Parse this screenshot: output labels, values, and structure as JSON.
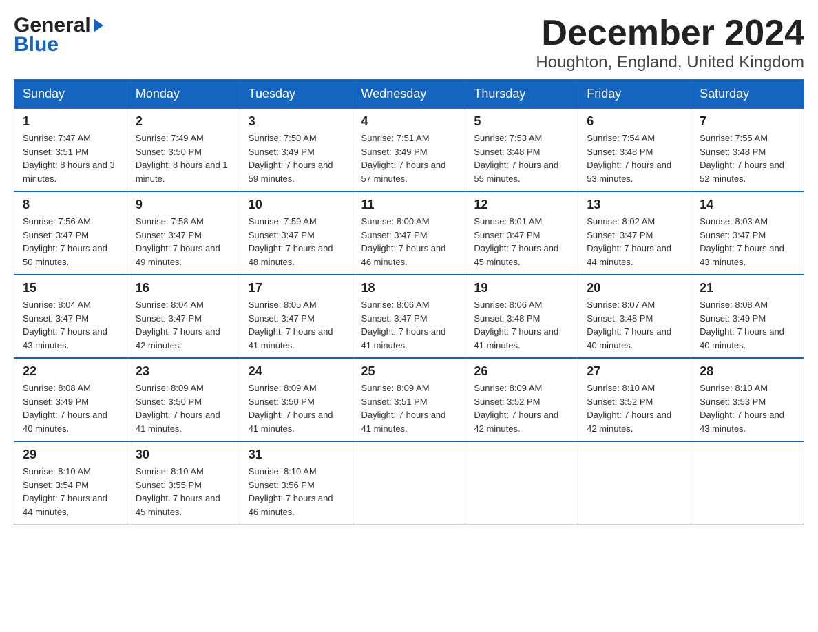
{
  "header": {
    "logo": {
      "line1": "General",
      "line2": "Blue",
      "arrow": "▶"
    },
    "title": "December 2024",
    "subtitle": "Houghton, England, United Kingdom"
  },
  "weekdays": [
    "Sunday",
    "Monday",
    "Tuesday",
    "Wednesday",
    "Thursday",
    "Friday",
    "Saturday"
  ],
  "weeks": [
    [
      {
        "day": "1",
        "sunrise": "7:47 AM",
        "sunset": "3:51 PM",
        "daylight": "8 hours and 3 minutes."
      },
      {
        "day": "2",
        "sunrise": "7:49 AM",
        "sunset": "3:50 PM",
        "daylight": "8 hours and 1 minute."
      },
      {
        "day": "3",
        "sunrise": "7:50 AM",
        "sunset": "3:49 PM",
        "daylight": "7 hours and 59 minutes."
      },
      {
        "day": "4",
        "sunrise": "7:51 AM",
        "sunset": "3:49 PM",
        "daylight": "7 hours and 57 minutes."
      },
      {
        "day": "5",
        "sunrise": "7:53 AM",
        "sunset": "3:48 PM",
        "daylight": "7 hours and 55 minutes."
      },
      {
        "day": "6",
        "sunrise": "7:54 AM",
        "sunset": "3:48 PM",
        "daylight": "7 hours and 53 minutes."
      },
      {
        "day": "7",
        "sunrise": "7:55 AM",
        "sunset": "3:48 PM",
        "daylight": "7 hours and 52 minutes."
      }
    ],
    [
      {
        "day": "8",
        "sunrise": "7:56 AM",
        "sunset": "3:47 PM",
        "daylight": "7 hours and 50 minutes."
      },
      {
        "day": "9",
        "sunrise": "7:58 AM",
        "sunset": "3:47 PM",
        "daylight": "7 hours and 49 minutes."
      },
      {
        "day": "10",
        "sunrise": "7:59 AM",
        "sunset": "3:47 PM",
        "daylight": "7 hours and 48 minutes."
      },
      {
        "day": "11",
        "sunrise": "8:00 AM",
        "sunset": "3:47 PM",
        "daylight": "7 hours and 46 minutes."
      },
      {
        "day": "12",
        "sunrise": "8:01 AM",
        "sunset": "3:47 PM",
        "daylight": "7 hours and 45 minutes."
      },
      {
        "day": "13",
        "sunrise": "8:02 AM",
        "sunset": "3:47 PM",
        "daylight": "7 hours and 44 minutes."
      },
      {
        "day": "14",
        "sunrise": "8:03 AM",
        "sunset": "3:47 PM",
        "daylight": "7 hours and 43 minutes."
      }
    ],
    [
      {
        "day": "15",
        "sunrise": "8:04 AM",
        "sunset": "3:47 PM",
        "daylight": "7 hours and 43 minutes."
      },
      {
        "day": "16",
        "sunrise": "8:04 AM",
        "sunset": "3:47 PM",
        "daylight": "7 hours and 42 minutes."
      },
      {
        "day": "17",
        "sunrise": "8:05 AM",
        "sunset": "3:47 PM",
        "daylight": "7 hours and 41 minutes."
      },
      {
        "day": "18",
        "sunrise": "8:06 AM",
        "sunset": "3:47 PM",
        "daylight": "7 hours and 41 minutes."
      },
      {
        "day": "19",
        "sunrise": "8:06 AM",
        "sunset": "3:48 PM",
        "daylight": "7 hours and 41 minutes."
      },
      {
        "day": "20",
        "sunrise": "8:07 AM",
        "sunset": "3:48 PM",
        "daylight": "7 hours and 40 minutes."
      },
      {
        "day": "21",
        "sunrise": "8:08 AM",
        "sunset": "3:49 PM",
        "daylight": "7 hours and 40 minutes."
      }
    ],
    [
      {
        "day": "22",
        "sunrise": "8:08 AM",
        "sunset": "3:49 PM",
        "daylight": "7 hours and 40 minutes."
      },
      {
        "day": "23",
        "sunrise": "8:09 AM",
        "sunset": "3:50 PM",
        "daylight": "7 hours and 41 minutes."
      },
      {
        "day": "24",
        "sunrise": "8:09 AM",
        "sunset": "3:50 PM",
        "daylight": "7 hours and 41 minutes."
      },
      {
        "day": "25",
        "sunrise": "8:09 AM",
        "sunset": "3:51 PM",
        "daylight": "7 hours and 41 minutes."
      },
      {
        "day": "26",
        "sunrise": "8:09 AM",
        "sunset": "3:52 PM",
        "daylight": "7 hours and 42 minutes."
      },
      {
        "day": "27",
        "sunrise": "8:10 AM",
        "sunset": "3:52 PM",
        "daylight": "7 hours and 42 minutes."
      },
      {
        "day": "28",
        "sunrise": "8:10 AM",
        "sunset": "3:53 PM",
        "daylight": "7 hours and 43 minutes."
      }
    ],
    [
      {
        "day": "29",
        "sunrise": "8:10 AM",
        "sunset": "3:54 PM",
        "daylight": "7 hours and 44 minutes."
      },
      {
        "day": "30",
        "sunrise": "8:10 AM",
        "sunset": "3:55 PM",
        "daylight": "7 hours and 45 minutes."
      },
      {
        "day": "31",
        "sunrise": "8:10 AM",
        "sunset": "3:56 PM",
        "daylight": "7 hours and 46 minutes."
      },
      null,
      null,
      null,
      null
    ]
  ]
}
